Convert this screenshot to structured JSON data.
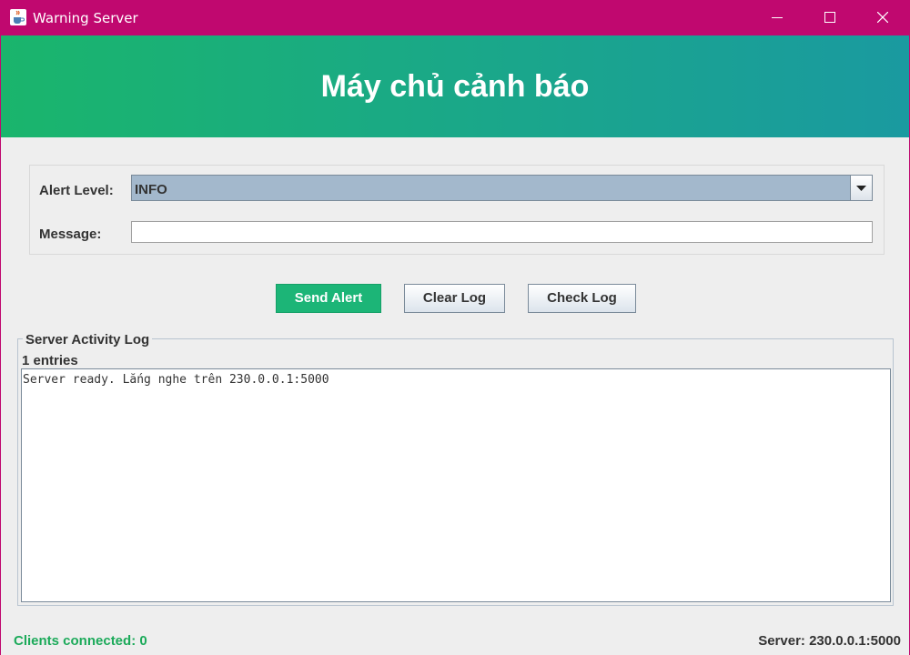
{
  "window": {
    "title": "Warning Server",
    "icon": "java-cup-icon",
    "controls": [
      "minimize-icon",
      "maximize-icon",
      "close-icon"
    ],
    "frame_color": "#c0086f"
  },
  "header": {
    "heading": "Máy chủ cảnh báo",
    "gradient": [
      "#1ab56c",
      "#1a9aa0"
    ]
  },
  "form": {
    "alert_level_label": "Alert Level:",
    "alert_level_value": "INFO",
    "message_label": "Message:",
    "message_value": ""
  },
  "buttons": {
    "send": "Send Alert",
    "clear": "Clear Log",
    "check": "Check Log",
    "primary_color": "#1cb577"
  },
  "log": {
    "title": "Server Activity Log",
    "entry_count": "1 entries",
    "lines": [
      "Server ready. Lắng nghe trên 230.0.0.1:5000"
    ]
  },
  "status": {
    "clients": "Clients connected: 0",
    "server": "Server: 230.0.0.1:5000",
    "clients_color": "#1caa5a"
  }
}
